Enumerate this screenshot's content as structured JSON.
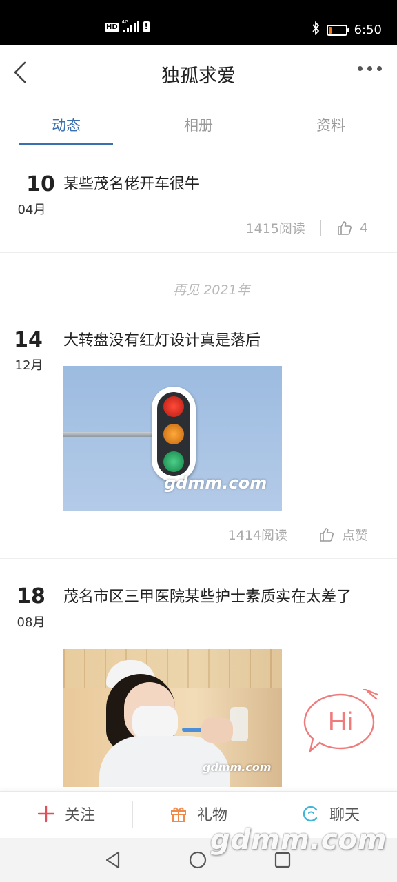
{
  "status_bar": {
    "network": "4G",
    "hd": "HD",
    "battery_level": 0.15,
    "time": "6:50"
  },
  "header": {
    "title": "独孤求爱"
  },
  "tabs": [
    {
      "label": "动态",
      "active": true
    },
    {
      "label": "相册"
    },
    {
      "label": "资料"
    }
  ],
  "posts": [
    {
      "day": "10",
      "month": "04月",
      "title": "某些茂名佬开车很牛",
      "reads": "1415阅读",
      "likes": "4"
    },
    {
      "day": "14",
      "month": "12月",
      "title": "大转盘没有红灯设计真是落后",
      "image_watermark": "gdmm.com",
      "reads": "1414阅读",
      "likes": "点赞"
    },
    {
      "day": "18",
      "month": "08月",
      "title": "茂名市区三甲医院某些护士素质实在太差了",
      "image_watermark": "gdmm.com"
    }
  ],
  "year_separator": "再见 2021年",
  "hi_button": "Hi",
  "bottom_bar": {
    "follow": "关注",
    "gift": "礼物",
    "chat": "聊天"
  },
  "site_watermark": "gdmm.com",
  "colors": {
    "accent": "#3a6fb0",
    "hi": "#ef7b7b",
    "follow": "#e0505a",
    "gift": "#f08a4b",
    "chat": "#3fb6d8"
  }
}
